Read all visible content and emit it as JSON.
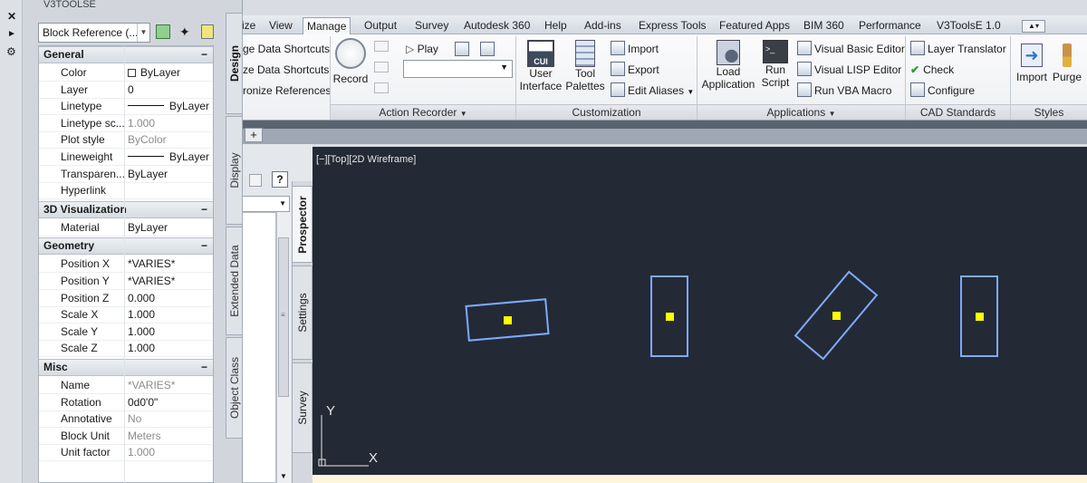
{
  "app": {
    "title": "V3TOOLSE"
  },
  "ribbon": {
    "tabs": [
      "ize",
      "View",
      "Manage",
      "Output",
      "Survey",
      "Autodesk 360",
      "Help",
      "Add-ins",
      "Express Tools",
      "Featured Apps",
      "BIM 360",
      "Performance",
      "V3ToolsE 1.0"
    ],
    "active_tab": "Manage",
    "panels": {
      "data_shortcuts": [
        "ge Data Shortcuts",
        "ze Data Shortcuts",
        "ronize References"
      ],
      "action_recorder": {
        "title": "Action Recorder",
        "record": "Record",
        "play": "Play"
      },
      "customization": {
        "title": "Customization",
        "user_interface": [
          "User",
          "Interface"
        ],
        "cui_badge": "CUI",
        "tool_palettes": [
          "Tool",
          "Palettes"
        ],
        "import": "Import",
        "export": "Export",
        "edit_aliases": "Edit Aliases"
      },
      "applications": {
        "title": "Applications",
        "load_application": [
          "Load",
          "Application"
        ],
        "run_script": [
          "Run",
          "Script"
        ],
        "visual_basic": "Visual Basic Editor",
        "visual_lisp": "Visual LISP Editor",
        "run_vba": "Run VBA Macro"
      },
      "cad_standards": {
        "title": "CAD Standards",
        "layer_translator": "Layer Translator",
        "check": "Check",
        "configure": "Configure"
      },
      "styles": {
        "title": "Styles",
        "import": "Import",
        "purge": "Purge"
      }
    }
  },
  "prospector": {
    "tabs": [
      "Prospector",
      "Settings",
      "Survey"
    ]
  },
  "properties": {
    "selection": "Block Reference (...",
    "side_tabs": [
      "Design",
      "Display",
      "Extended Data",
      "Object Class"
    ],
    "sections": [
      {
        "title": "General",
        "rows": [
          {
            "name": "Color",
            "value": "ByLayer",
            "grey": false
          },
          {
            "name": "Layer",
            "value": "0",
            "grey": false
          },
          {
            "name": "Linetype",
            "value": "ByLayer",
            "grey": false
          },
          {
            "name": "Linetype sc...",
            "value": "1.000",
            "grey": true
          },
          {
            "name": "Plot style",
            "value": "ByColor",
            "grey": true
          },
          {
            "name": "Lineweight",
            "value": "ByLayer",
            "grey": false
          },
          {
            "name": "Transparen...",
            "value": "ByLayer",
            "grey": false
          },
          {
            "name": "Hyperlink",
            "value": "",
            "grey": false
          }
        ]
      },
      {
        "title": "3D Visualization",
        "rows": [
          {
            "name": "Material",
            "value": "ByLayer",
            "grey": false
          }
        ]
      },
      {
        "title": "Geometry",
        "rows": [
          {
            "name": "Position X",
            "value": "*VARIES*",
            "grey": false
          },
          {
            "name": "Position Y",
            "value": "*VARIES*",
            "grey": false
          },
          {
            "name": "Position Z",
            "value": "0.000",
            "grey": false
          },
          {
            "name": "Scale X",
            "value": "1.000",
            "grey": false
          },
          {
            "name": "Scale Y",
            "value": "1.000",
            "grey": false
          },
          {
            "name": "Scale Z",
            "value": "1.000",
            "grey": false
          }
        ]
      },
      {
        "title": "Misc",
        "rows": [
          {
            "name": "Name",
            "value": "*VARIES*",
            "grey": true
          },
          {
            "name": "Rotation",
            "value": "0d0'0\"",
            "grey": false
          },
          {
            "name": "Annotative",
            "value": "No",
            "grey": true
          },
          {
            "name": "Block Unit",
            "value": "Meters",
            "grey": true
          },
          {
            "name": "Unit factor",
            "value": "1.000",
            "grey": true
          }
        ]
      }
    ]
  },
  "viewport": {
    "label": "[−][Top][2D Wireframe]",
    "axis_x": "X",
    "axis_y": "Y",
    "colors": {
      "background": "#232a35",
      "block_outline": "#7fa9ff",
      "insertion_point": "#ffff00"
    },
    "blocks": [
      {
        "rotation_deg": 5
      },
      {
        "rotation_deg": 0
      },
      {
        "rotation_deg": -40
      },
      {
        "rotation_deg": 0
      }
    ]
  }
}
